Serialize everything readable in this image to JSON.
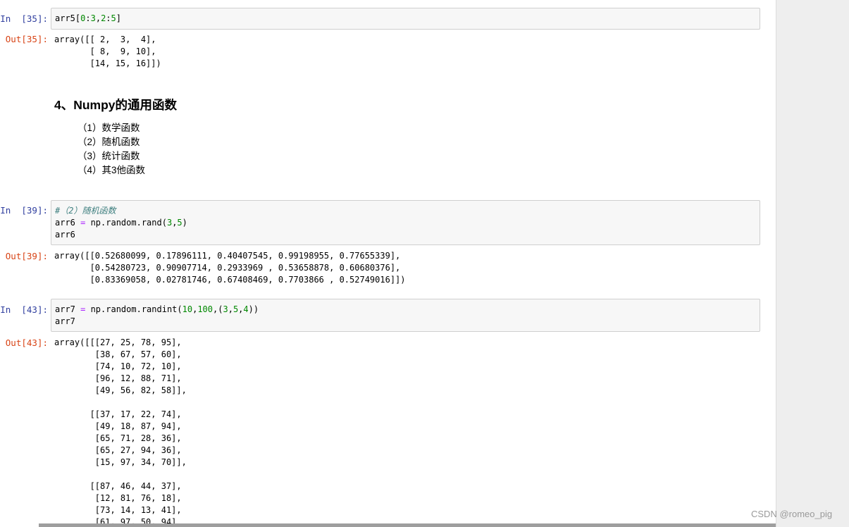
{
  "cells": [
    {
      "in_prompt": "In  [35]:",
      "code_lines": [
        "arr5[0:3,2:5]"
      ],
      "out_prompt": "Out[35]:",
      "output": "array([[ 2,  3,  4],\n       [ 8,  9, 10],\n       [14, 15, 16]])"
    },
    {
      "in_prompt": "In  [39]:",
      "code_lines": [
        "#（2）随机函数",
        "arr6 = np.random.rand(3,5)",
        "arr6"
      ],
      "out_prompt": "Out[39]:",
      "output": "array([[0.52680099, 0.17896111, 0.40407545, 0.99198955, 0.77655339],\n       [0.54280723, 0.90907714, 0.2933969 , 0.53658878, 0.60680376],\n       [0.83369058, 0.02781746, 0.67408469, 0.7703866 , 0.52749016]])"
    },
    {
      "in_prompt": "In  [43]:",
      "code_lines": [
        "arr7 = np.random.randint(10,100,(3,5,4))",
        "arr7"
      ],
      "out_prompt": "Out[43]:",
      "output": "array([[[27, 25, 78, 95],\n        [38, 67, 57, 60],\n        [74, 10, 72, 10],\n        [96, 12, 88, 71],\n        [49, 56, 82, 58]],\n\n       [[37, 17, 22, 74],\n        [49, 18, 87, 94],\n        [65, 71, 28, 36],\n        [65, 27, 94, 36],\n        [15, 97, 34, 70]],\n\n       [[87, 46, 44, 37],\n        [12, 81, 76, 18],\n        [73, 14, 13, 41],\n        [61, 97, 50, 94]"
    }
  ],
  "markdown": {
    "heading": "4、Numpy的通用函数",
    "items": [
      "（1）数学函数",
      "（2）随机函数",
      "（3）统计函数",
      "（4）其3他函数"
    ]
  },
  "watermark": "CSDN @romeo_pig",
  "colors": {
    "in_prompt": "#303f9f",
    "out_prompt": "#d84315",
    "comment": "#408080",
    "number": "#008800",
    "operator": "#aa22ff"
  }
}
